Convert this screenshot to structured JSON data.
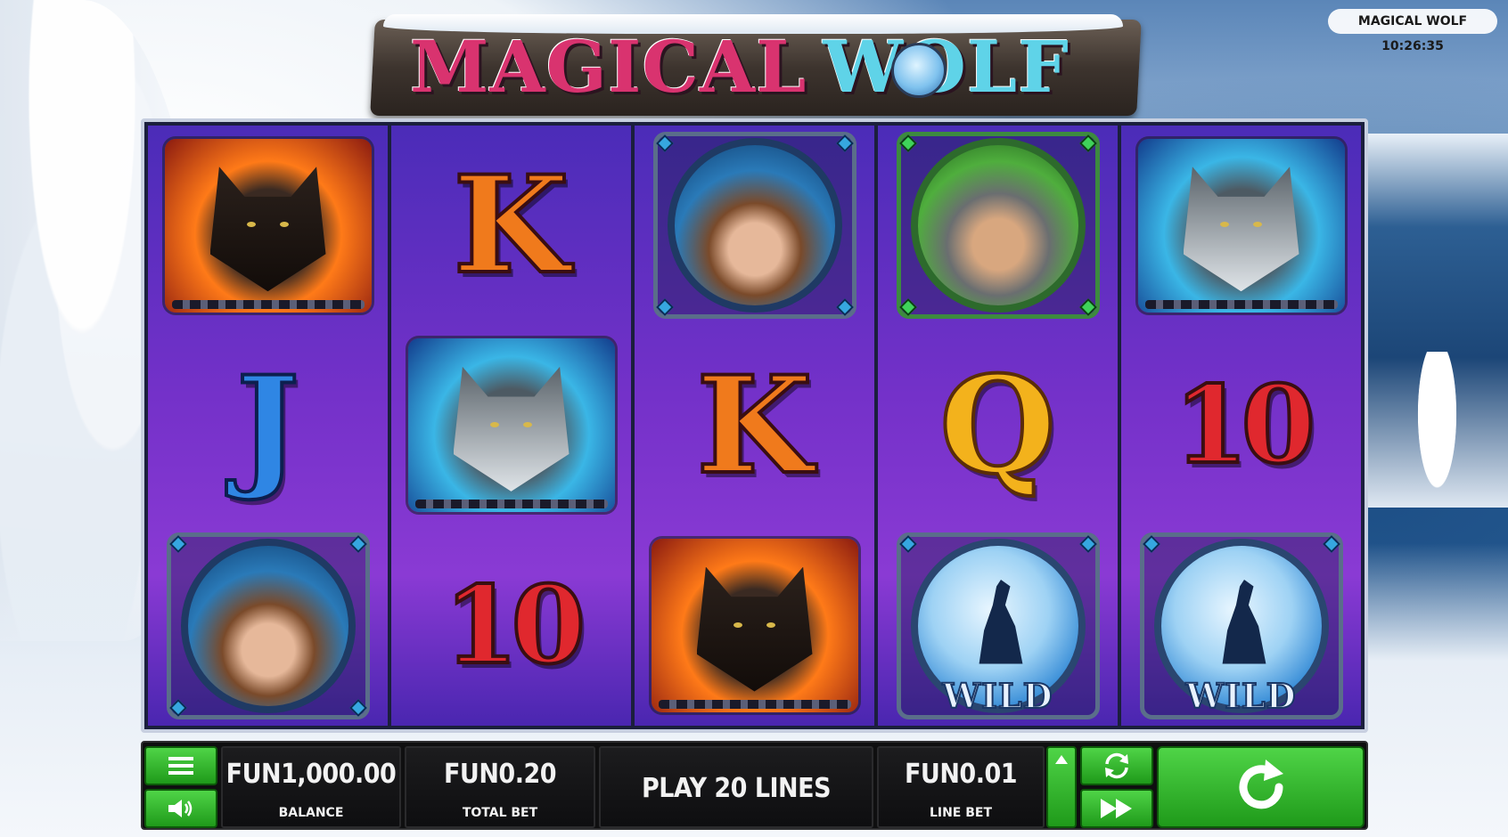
{
  "logo": {
    "word1": "MAGICAL",
    "word2": "WOLF"
  },
  "clock": {
    "text": "MAGICAL WOLF 10:26:35"
  },
  "reels": [
    [
      "wolf-black",
      "J",
      "medal-woman"
    ],
    [
      "K",
      "wolf-grey",
      "10"
    ],
    [
      "medal-woman",
      "K",
      "wolf-black"
    ],
    [
      "medal-man",
      "Q",
      "wild"
    ],
    [
      "wolf-grey",
      "10",
      "wild"
    ]
  ],
  "symbols": {
    "k": "K",
    "j": "J",
    "q": "Q",
    "ten": "10",
    "wild": "WILD"
  },
  "controls": {
    "balance": {
      "value": "FUN1,000.00",
      "label": "BALANCE"
    },
    "total_bet": {
      "value": "FUN0.20",
      "label": "TOTAL BET"
    },
    "lines": {
      "value": "PLAY 20 LINES"
    },
    "line_bet": {
      "value": "FUN0.01",
      "label": "LINE BET"
    }
  },
  "icons": {
    "menu": "menu-icon",
    "sound": "speaker-icon",
    "autoplay": "autoplay-icon",
    "fast": "fast-forward-icon",
    "spin": "spin-icon",
    "arrow_up": "arrow-up-icon"
  },
  "colors": {
    "accent_green": "#2fb82a",
    "reel_purple": "#7431c9"
  }
}
